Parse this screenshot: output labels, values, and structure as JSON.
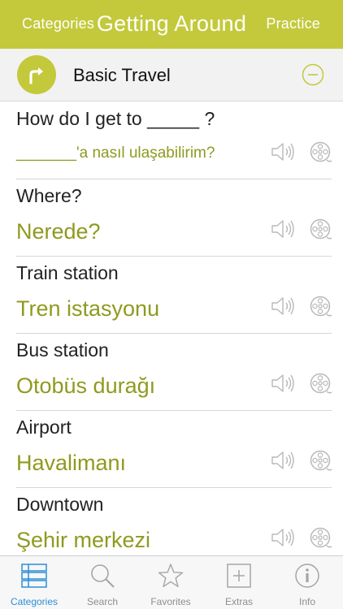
{
  "nav": {
    "left_label": "Categories",
    "title": "Getting Around",
    "right_label": "Practice"
  },
  "section": {
    "title": "Basic Travel",
    "icon": "turn-right-arrow-icon",
    "collapse_icon": "minus-circle-icon"
  },
  "phrases": [
    {
      "en": "How do I get to _____ ?",
      "tr": "_______'a nasıl ulaşabilirim?"
    },
    {
      "en": "Where?",
      "tr": "Nerede?"
    },
    {
      "en": "Train station",
      "tr": "Tren istasyonu"
    },
    {
      "en": "Bus station",
      "tr": "Otobüs durağı"
    },
    {
      "en": "Airport",
      "tr": "Havalimanı"
    },
    {
      "en": "Downtown",
      "tr": "Şehir merkezi"
    }
  ],
  "tabs": [
    {
      "label": "Categories",
      "icon": "list-icon",
      "active": true
    },
    {
      "label": "Search",
      "icon": "search-icon",
      "active": false
    },
    {
      "label": "Favorites",
      "icon": "star-icon",
      "active": false
    },
    {
      "label": "Extras",
      "icon": "plus-square-icon",
      "active": false
    },
    {
      "label": "Info",
      "icon": "info-icon",
      "active": false
    }
  ],
  "colors": {
    "accent": "#c3c93b",
    "translation_text": "#8f9a1f",
    "active_tab": "#2a8fd6",
    "inactive_tab": "#8e8e93"
  }
}
